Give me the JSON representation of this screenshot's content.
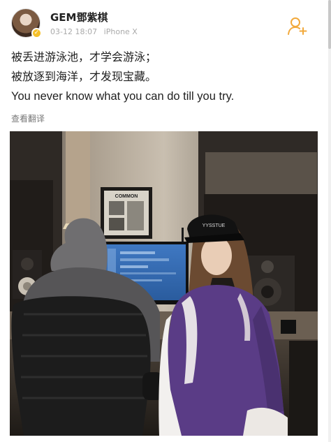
{
  "post": {
    "username": "GEM鄧紫棋",
    "date": "03-12 18:07",
    "device": "iPhone X",
    "text_lines": [
      "被丢进游泳池，才学会游泳；",
      "被放逐到海洋，才发现宝藏。",
      "You never know what you can do till you try."
    ],
    "translate_label": "查看翻译",
    "image_text": {
      "poster_title": "COMMON",
      "cap_text": "YYSSTUE"
    }
  },
  "colors": {
    "accent": "#f2a93b",
    "verified": "#f5c02a",
    "meta_text": "#aaaaaa"
  },
  "icons": {
    "follow": "add-user-icon",
    "verified": "verified-badge-icon"
  }
}
